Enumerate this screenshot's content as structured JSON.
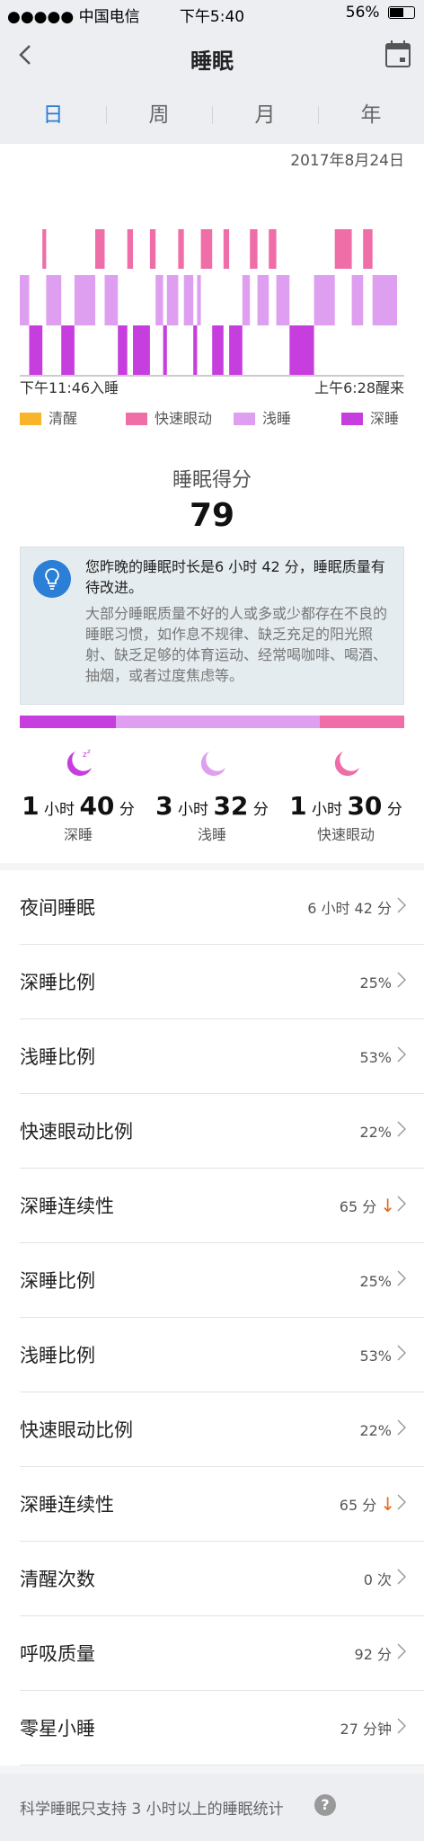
{
  "status_bar": {
    "carrier": "●●●●● 中国电信",
    "time": "下午5:40",
    "battery": "56%"
  },
  "nav": {
    "title": "睡眠"
  },
  "tabs": [
    {
      "label": "日"
    },
    {
      "label": "周"
    },
    {
      "label": "月"
    },
    {
      "label": "年"
    }
  ],
  "date": "2017年8月24日",
  "bedtime": "下午11:46入睡",
  "waketime": "上午6:28醒来",
  "legend": [
    {
      "label": "清醒",
      "color": "#f8b52a"
    },
    {
      "label": "快速眼动",
      "color": "#ef6ea8"
    },
    {
      "label": "浅睡",
      "color": "#df9ff0"
    },
    {
      "label": "深睡",
      "color": "#c63fde"
    }
  ],
  "chart_data": {
    "type": "hypnogram",
    "levels": [
      "深睡",
      "浅睡",
      "快速眼动"
    ],
    "x_start": "下午11:46",
    "x_end": "上午6:28",
    "segments": [
      {
        "level": "浅睡",
        "start": 0.0,
        "end": 0.025
      },
      {
        "level": "深睡",
        "start": 0.025,
        "end": 0.06
      },
      {
        "level": "快速眼动",
        "start": 0.06,
        "end": 0.07
      },
      {
        "level": "浅睡",
        "start": 0.07,
        "end": 0.11
      },
      {
        "level": "深睡",
        "start": 0.11,
        "end": 0.145
      },
      {
        "level": "浅睡",
        "start": 0.145,
        "end": 0.2
      },
      {
        "level": "快速眼动",
        "start": 0.2,
        "end": 0.225
      },
      {
        "level": "浅睡",
        "start": 0.225,
        "end": 0.26
      },
      {
        "level": "深睡",
        "start": 0.26,
        "end": 0.285
      },
      {
        "level": "快速眼动",
        "start": 0.285,
        "end": 0.3
      },
      {
        "level": "深睡",
        "start": 0.3,
        "end": 0.345
      },
      {
        "level": "快速眼动",
        "start": 0.345,
        "end": 0.36
      },
      {
        "level": "浅睡",
        "start": 0.36,
        "end": 0.38
      },
      {
        "level": "深睡",
        "start": 0.38,
        "end": 0.39
      },
      {
        "level": "浅睡",
        "start": 0.39,
        "end": 0.42
      },
      {
        "level": "快速眼动",
        "start": 0.42,
        "end": 0.435
      },
      {
        "level": "浅睡",
        "start": 0.435,
        "end": 0.46
      },
      {
        "level": "深睡",
        "start": 0.46,
        "end": 0.47
      },
      {
        "level": "浅睡",
        "start": 0.47,
        "end": 0.48
      },
      {
        "level": "快速眼动",
        "start": 0.48,
        "end": 0.51
      },
      {
        "level": "深睡",
        "start": 0.51,
        "end": 0.54
      },
      {
        "level": "快速眼动",
        "start": 0.54,
        "end": 0.555
      },
      {
        "level": "深睡",
        "start": 0.555,
        "end": 0.59
      },
      {
        "level": "浅睡",
        "start": 0.59,
        "end": 0.61
      },
      {
        "level": "快速眼动",
        "start": 0.61,
        "end": 0.63
      },
      {
        "level": "浅睡",
        "start": 0.63,
        "end": 0.66
      },
      {
        "level": "快速眼动",
        "start": 0.66,
        "end": 0.68
      },
      {
        "level": "浅睡",
        "start": 0.68,
        "end": 0.715
      },
      {
        "level": "深睡",
        "start": 0.715,
        "end": 0.78
      },
      {
        "level": "浅睡",
        "start": 0.78,
        "end": 0.835
      },
      {
        "level": "快速眼动",
        "start": 0.835,
        "end": 0.88
      },
      {
        "level": "浅睡",
        "start": 0.88,
        "end": 0.91
      },
      {
        "level": "快速眼动",
        "start": 0.91,
        "end": 0.935
      },
      {
        "level": "浅睡",
        "start": 0.935,
        "end": 1.0
      }
    ]
  },
  "score": {
    "label": "睡眠得分",
    "value": "79"
  },
  "advice": {
    "title": "您昨晚的睡眠时长是6 小时 42 分，睡眠质量有待改进。",
    "body": "大部分睡眠质量不好的人或多或少都存在不良的睡眠习惯，如作息不规律、缺乏充足的阳光照射、缺乏足够的体育运动、经常喝咖啡、喝酒、抽烟，或者过度焦虑等。"
  },
  "stage_bar": [
    {
      "stage": "深睡",
      "fraction": 0.25,
      "color": "#c63fde"
    },
    {
      "stage": "浅睡",
      "fraction": 0.53,
      "color": "#df9ff0"
    },
    {
      "stage": "快速眼动",
      "fraction": 0.22,
      "color": "#ef6ea8"
    }
  ],
  "stages": [
    {
      "name": "深睡",
      "h": "1",
      "h_unit": "小时",
      "m": "40",
      "m_unit": "分",
      "color": "#c63fde",
      "icon": "moon-zzz-icon"
    },
    {
      "name": "浅睡",
      "h": "3",
      "h_unit": "小时",
      "m": "32",
      "m_unit": "分",
      "color": "#df9ff0",
      "icon": "moon-icon"
    },
    {
      "name": "快速眼动",
      "h": "1",
      "h_unit": "小时",
      "m": "30",
      "m_unit": "分",
      "color": "#ef6ea8",
      "icon": "moon-icon"
    }
  ],
  "rows": [
    {
      "label": "夜间睡眠",
      "value": "6 小时 42 分",
      "trend": ""
    },
    {
      "label": "深睡比例",
      "value": "25%",
      "trend": ""
    },
    {
      "label": "浅睡比例",
      "value": "53%",
      "trend": ""
    },
    {
      "label": "快速眼动比例",
      "value": "22%",
      "trend": ""
    },
    {
      "label": "深睡连续性",
      "value": "65 分",
      "trend": "↓"
    },
    {
      "label": "深睡比例",
      "value": "25%",
      "trend": ""
    },
    {
      "label": "浅睡比例",
      "value": "53%",
      "trend": ""
    },
    {
      "label": "快速眼动比例",
      "value": "22%",
      "trend": ""
    },
    {
      "label": "深睡连续性",
      "value": "65 分",
      "trend": "↓"
    },
    {
      "label": "清醒次数",
      "value": "0 次",
      "trend": ""
    },
    {
      "label": "呼吸质量",
      "value": "92 分",
      "trend": ""
    },
    {
      "label": "零星小睡",
      "value": "27 分钟",
      "trend": ""
    }
  ],
  "footer": {
    "text": "科学睡眠只支持 3 小时以上的睡眠统计",
    "help": "?"
  }
}
